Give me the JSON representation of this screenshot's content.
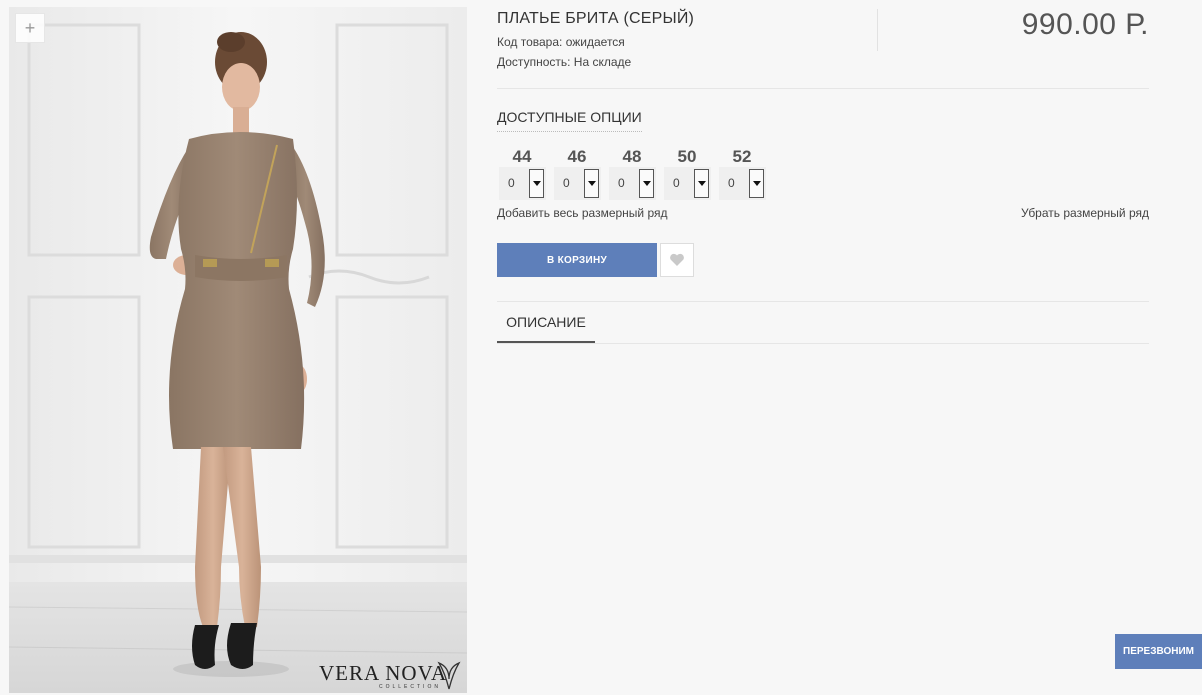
{
  "product": {
    "title": "ПЛАТЬЕ БРИТА (СЕРЫЙ)",
    "code_label": "Код товара:",
    "code_value": "ожидается",
    "availability_label": "Доступность:",
    "availability_value": "На складе",
    "price": "990.00 Р.",
    "image_alt": "Платье Брита (серый)"
  },
  "gallery": {
    "zoom_label": "+",
    "brand_name": "VERA NOVA",
    "brand_sub": "COLLECTION"
  },
  "options": {
    "heading": "ДОСТУПНЫЕ ОПЦИИ",
    "sizes": [
      {
        "label": "44",
        "qty": "0"
      },
      {
        "label": "46",
        "qty": "0"
      },
      {
        "label": "48",
        "qty": "0"
      },
      {
        "label": "50",
        "qty": "0"
      },
      {
        "label": "52",
        "qty": "0"
      }
    ],
    "add_all_label": "Добавить весь размерный ряд",
    "remove_all_label": "Убрать размерный ряд"
  },
  "actions": {
    "cart_label": "В КОРЗИНУ",
    "wishlist_icon": "heart-icon"
  },
  "tabs": [
    {
      "label": "ОПИСАНИЕ",
      "active": true
    }
  ],
  "callback": {
    "label": "ПЕРЕЗВОНИМ"
  },
  "colors": {
    "accent": "#5e7fba",
    "dress": "#9a8472"
  }
}
